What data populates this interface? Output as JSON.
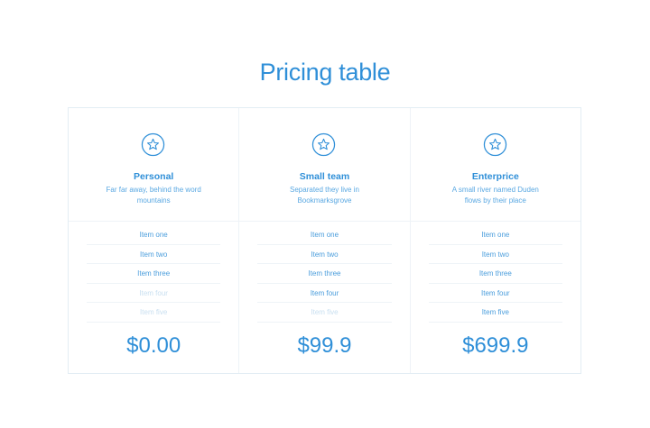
{
  "title": "Pricing table",
  "colors": {
    "accent": "#2f8fd8",
    "muted": "#c8dff0",
    "border": "#e3edf4"
  },
  "plans": [
    {
      "icon": "star-icon",
      "name": "Personal",
      "description": "Far far away, behind the word mountains",
      "features": [
        {
          "label": "Item one",
          "enabled": true
        },
        {
          "label": "Item two",
          "enabled": true
        },
        {
          "label": "Item three",
          "enabled": true
        },
        {
          "label": "Item four",
          "enabled": false
        },
        {
          "label": "Item five",
          "enabled": false
        }
      ],
      "price": "$0.00"
    },
    {
      "icon": "star-icon",
      "name": "Small team",
      "description": "Separated they live in Bookmarksgrove",
      "features": [
        {
          "label": "Item one",
          "enabled": true
        },
        {
          "label": "Item two",
          "enabled": true
        },
        {
          "label": "Item three",
          "enabled": true
        },
        {
          "label": "Item four",
          "enabled": true
        },
        {
          "label": "Item five",
          "enabled": false
        }
      ],
      "price": "$99.9"
    },
    {
      "icon": "star-icon",
      "name": "Enterprice",
      "description": "A small river named Duden flows by their place",
      "features": [
        {
          "label": "Item one",
          "enabled": true
        },
        {
          "label": "Item two",
          "enabled": true
        },
        {
          "label": "Item three",
          "enabled": true
        },
        {
          "label": "Item four",
          "enabled": true
        },
        {
          "label": "Item five",
          "enabled": true
        }
      ],
      "price": "$699.9"
    }
  ]
}
